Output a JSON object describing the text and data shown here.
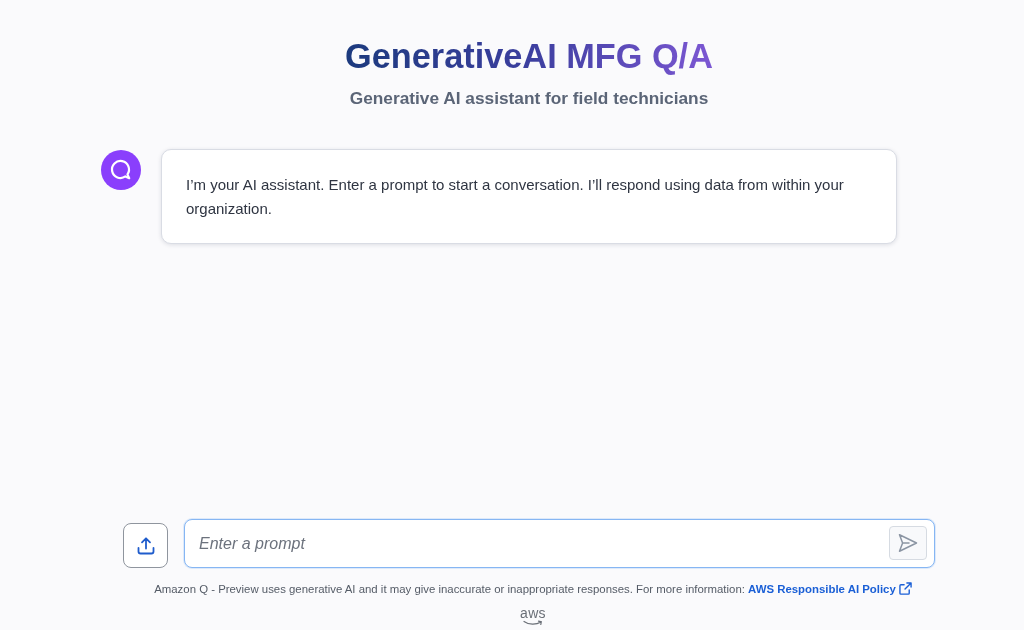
{
  "header": {
    "title": "GenerativeAI MFG Q/A",
    "subtitle": "Generative AI assistant for field technicians"
  },
  "messages": [
    {
      "kind": "assistant",
      "text": "I’m your AI assistant. Enter a prompt to start a conversation. I’ll respond using data from within your organization."
    }
  ],
  "prompt": {
    "placeholder": "Enter a prompt"
  },
  "footer": {
    "disclaimer": "Amazon Q - Preview uses generative AI and it may give inaccurate or inappropriate responses. For more information:",
    "link": "AWS Responsible AI Policy",
    "logo": "aws"
  }
}
